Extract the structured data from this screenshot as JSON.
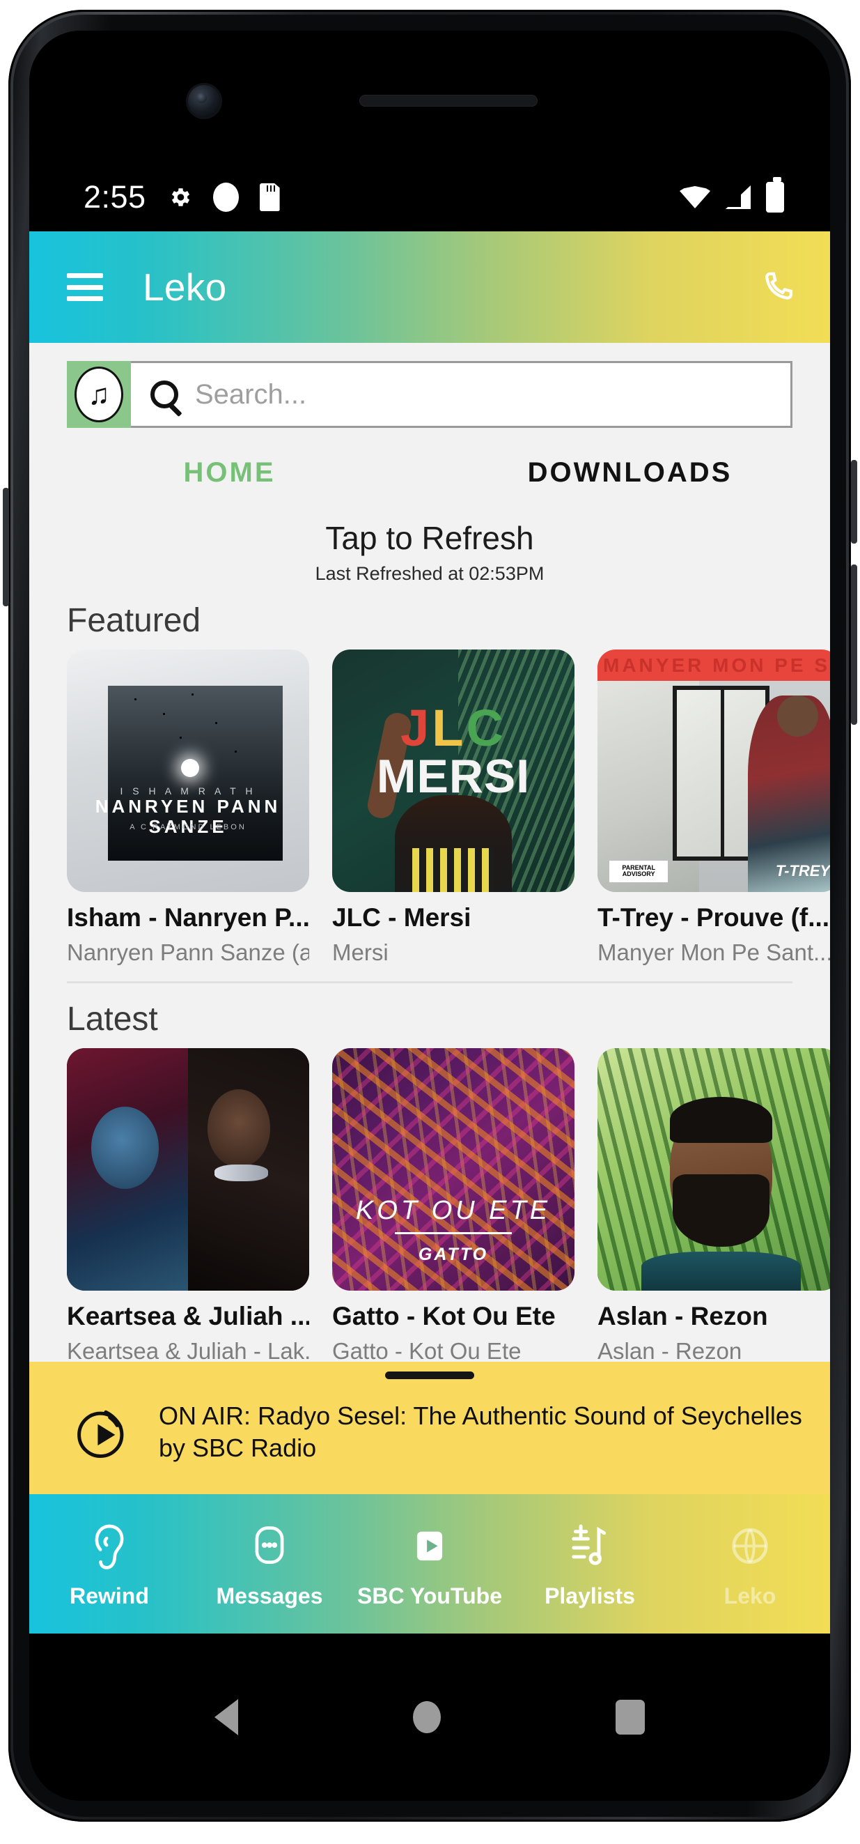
{
  "status_bar": {
    "time": "2:55",
    "left_icons": [
      "gear-icon",
      "circle-icon",
      "sd-card-icon"
    ],
    "right_icons": [
      "wifi-icon",
      "signal-icon",
      "battery-icon"
    ]
  },
  "app_bar": {
    "menu_icon": "hamburger-menu-icon",
    "title": "Leko",
    "action_icon": "phone-call-icon",
    "gradient_start": "#18c3de",
    "gradient_end": "#f2dd55"
  },
  "search": {
    "music_icon": "music-note-icon",
    "search_icon": "search-icon",
    "placeholder": "Search...",
    "value": "",
    "chip_color": "#8bc68b"
  },
  "tabs": [
    {
      "label": "HOME",
      "active": true,
      "color": "#77c077"
    },
    {
      "label": "DOWNLOADS",
      "active": false,
      "color": "#121212"
    }
  ],
  "refresh": {
    "title": "Tap to Refresh",
    "subtitle": "Last Refreshed at  02:53PM"
  },
  "sections": [
    {
      "title": "Featured",
      "cards": [
        {
          "title": "Isham - Nanryen P...",
          "subtitle": "Nanryen Pann Sanze (a...",
          "art": {
            "style": "art1",
            "artist_line": "I S H A M   R A T H",
            "title_line": "NANRYEN PANN SANZE",
            "credit_line": "A C RAYMOND LEBON"
          }
        },
        {
          "title": "JLC - Mersi",
          "subtitle": "Mersi",
          "art": {
            "style": "art2",
            "logo_j": "J",
            "logo_l": "L",
            "logo_c": "C",
            "word": "MERSI"
          }
        },
        {
          "title": "T-Trey - Prouve (f...",
          "subtitle": "Manyer Mon Pe Sant...",
          "art": {
            "style": "art3",
            "banner": "MANYER MON PE S",
            "advisory": "PARENTAL ADVISORY",
            "tag": "T-TREY"
          }
        }
      ]
    },
    {
      "title": "Latest",
      "cards": [
        {
          "title": "Keartsea & Juliah ...",
          "subtitle": "Keartsea & Juliah - Lak...",
          "art": {
            "style": "art4"
          }
        },
        {
          "title": "Gatto - Kot Ou Ete",
          "subtitle": "Gatto - Kot Ou Ete",
          "art": {
            "style": "art5",
            "title_line": "KOT OU ETE",
            "artist_line": "GATTO"
          }
        },
        {
          "title": "Aslan - Rezon",
          "subtitle": "Aslan - Rezon",
          "art": {
            "style": "art6"
          }
        }
      ]
    }
  ],
  "on_air": {
    "icon": "broadcast-play-icon",
    "line1": "ON AIR: Radyo Sesel: The Authentic Sound of Seychelles",
    "line2": "by SBC Radio",
    "background": "#fada5e",
    "drag_handle": "drag-handle"
  },
  "bottom_nav": [
    {
      "label": "Rewind",
      "icon": "ear-icon",
      "disabled": false
    },
    {
      "label": "Messages",
      "icon": "message-bubble-icon",
      "disabled": false
    },
    {
      "label": "SBC YouTube",
      "icon": "play-button-icon",
      "disabled": false
    },
    {
      "label": "Playlists",
      "icon": "playlist-add-icon",
      "disabled": false
    },
    {
      "label": "Leko",
      "icon": "leko-globe-icon",
      "disabled": true
    }
  ],
  "android_nav": [
    {
      "name": "back-button"
    },
    {
      "name": "home-button"
    },
    {
      "name": "recents-button"
    }
  ]
}
